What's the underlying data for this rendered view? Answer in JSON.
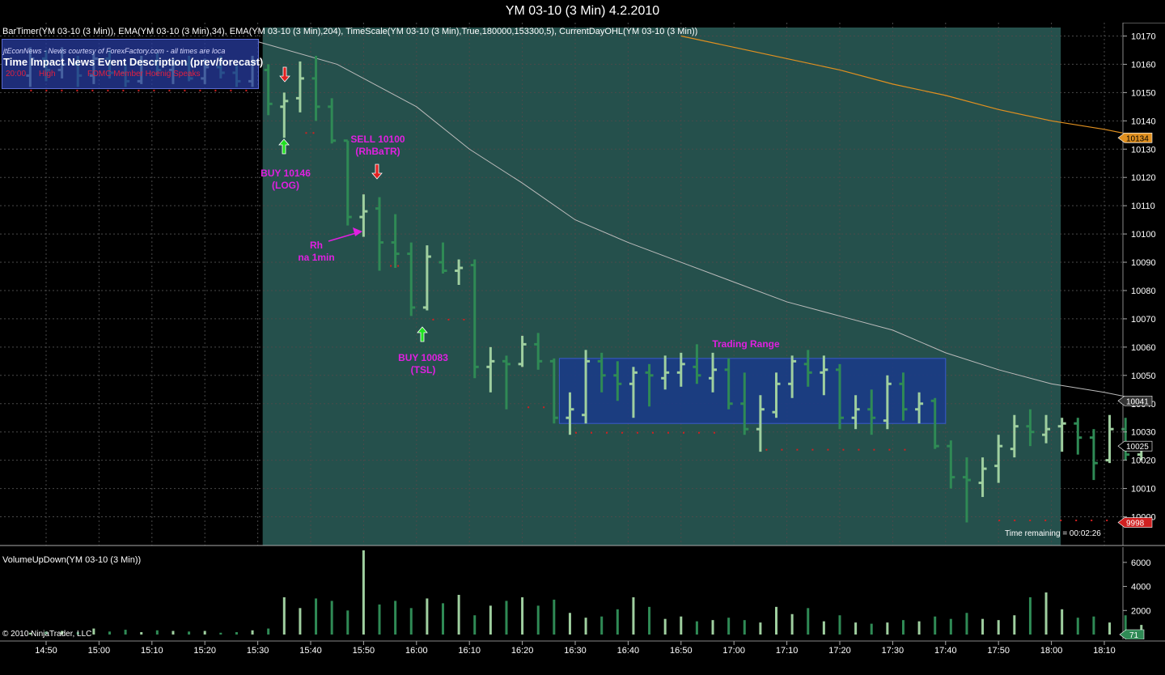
{
  "window_title": "YM 03-10 (3 Min)  4.2.2010",
  "indicator_label": "BarTimer(YM 03-10 (3 Min)), EMA(YM 03-10 (3 Min),34), EMA(YM 03-10 (3 Min),204), TimeScale(YM 03-10 (3 Min),True,180000,153300,5), CurrentDayOHL(YM 03-10 (3 Min))",
  "news": {
    "title": "jtEconNews - News courtesy of ForexFactory.com - all times are loca",
    "header": "Time   Impact    News Event Description  (prev/forecast)",
    "time": "20:00",
    "impact": "High",
    "event": "FOMC Member Hoenig Speaks"
  },
  "annotations": {
    "buy1": [
      "BUY 10146",
      "(LOG)"
    ],
    "sell1": [
      "SELL 10100",
      "(RhBaTR)"
    ],
    "rh": [
      "Rh",
      "na 1min"
    ],
    "buy2": [
      "BUY 10083",
      "(TSL)"
    ],
    "range": "Trading Range"
  },
  "time_remaining": "Time remaining = 00:02:26",
  "volume_label": "VolumeUpDown(YM 03-10 (3 Min))",
  "copyright": "© 2010 NinjaTrader, LLC",
  "colors": {
    "background": "#000000",
    "session_bg": "#25504c",
    "range_box": "#1a3a8a",
    "up_bar": "#9fcf9f",
    "down_bar": "#2f8a55",
    "ema34": "#bbbbbb",
    "ema204": "#e09020",
    "annotation": "#e020e0",
    "dots": "#d02020"
  },
  "chart_data": {
    "type": "ohlc",
    "title": "YM 03-10 (3 Min)  4.2.2010",
    "y_ticks": [
      10170,
      10160,
      10150,
      10140,
      10130,
      10120,
      10110,
      10100,
      10090,
      10080,
      10070,
      10060,
      10050,
      10040,
      10030,
      10020,
      10010,
      10000
    ],
    "y_range": [
      9995,
      10173
    ],
    "x_ticks": [
      "14:50",
      "15:00",
      "15:10",
      "15:20",
      "15:30",
      "15:40",
      "15:50",
      "16:00",
      "16:10",
      "16:20",
      "16:30",
      "16:40",
      "16:50",
      "17:00",
      "17:10",
      "17:20",
      "17:30",
      "17:40",
      "17:50",
      "18:00",
      "18:10"
    ],
    "price_markers": {
      "ema204": 10134,
      "ema34": 10041,
      "last": 10025,
      "low": 9998
    },
    "ema34": [
      {
        "t": "15:30",
        "v": 10168
      },
      {
        "t": "15:45",
        "v": 10160
      },
      {
        "t": "16:00",
        "v": 10145
      },
      {
        "t": "16:10",
        "v": 10130
      },
      {
        "t": "16:20",
        "v": 10118
      },
      {
        "t": "16:30",
        "v": 10105
      },
      {
        "t": "16:40",
        "v": 10097
      },
      {
        "t": "16:50",
        "v": 10090
      },
      {
        "t": "17:00",
        "v": 10083
      },
      {
        "t": "17:10",
        "v": 10076
      },
      {
        "t": "17:20",
        "v": 10071
      },
      {
        "t": "17:30",
        "v": 10066
      },
      {
        "t": "17:40",
        "v": 10058
      },
      {
        "t": "17:50",
        "v": 10052
      },
      {
        "t": "18:00",
        "v": 10047
      },
      {
        "t": "18:10",
        "v": 10044
      },
      {
        "t": "18:18",
        "v": 10041
      }
    ],
    "ema204": [
      {
        "t": "16:50",
        "v": 10170
      },
      {
        "t": "17:00",
        "v": 10166
      },
      {
        "t": "17:10",
        "v": 10162
      },
      {
        "t": "17:20",
        "v": 10158
      },
      {
        "t": "17:30",
        "v": 10153
      },
      {
        "t": "17:40",
        "v": 10149
      },
      {
        "t": "17:50",
        "v": 10144
      },
      {
        "t": "18:00",
        "v": 10140
      },
      {
        "t": "18:10",
        "v": 10137
      },
      {
        "t": "18:18",
        "v": 10134
      }
    ],
    "bars": [
      {
        "t": "14:47",
        "o": 10156,
        "h": 10166,
        "l": 10152,
        "c": 10162
      },
      {
        "t": "14:50",
        "o": 10162,
        "h": 10165,
        "l": 10154,
        "c": 10158
      },
      {
        "t": "14:53",
        "o": 10158,
        "h": 10166,
        "l": 10155,
        "c": 10160
      },
      {
        "t": "14:56",
        "o": 10160,
        "h": 10163,
        "l": 10152,
        "c": 10156
      },
      {
        "t": "14:59",
        "o": 10156,
        "h": 10164,
        "l": 10153,
        "c": 10162
      },
      {
        "t": "15:02",
        "o": 10162,
        "h": 10165,
        "l": 10155,
        "c": 10157
      },
      {
        "t": "15:05",
        "o": 10157,
        "h": 10160,
        "l": 10152,
        "c": 10154
      },
      {
        "t": "15:08",
        "o": 10154,
        "h": 10163,
        "l": 10153,
        "c": 10161
      },
      {
        "t": "15:11",
        "o": 10161,
        "h": 10164,
        "l": 10156,
        "c": 10158
      },
      {
        "t": "15:14",
        "o": 10158,
        "h": 10162,
        "l": 10153,
        "c": 10160
      },
      {
        "t": "15:17",
        "o": 10160,
        "h": 10163,
        "l": 10154,
        "c": 10155
      },
      {
        "t": "15:20",
        "o": 10155,
        "h": 10162,
        "l": 10153,
        "c": 10159
      },
      {
        "t": "15:23",
        "o": 10159,
        "h": 10163,
        "l": 10155,
        "c": 10157
      },
      {
        "t": "15:26",
        "o": 10157,
        "h": 10160,
        "l": 10152,
        "c": 10154
      },
      {
        "t": "15:29",
        "o": 10154,
        "h": 10163,
        "l": 10152,
        "c": 10161
      },
      {
        "t": "15:32",
        "o": 10158,
        "h": 10160,
        "l": 10142,
        "c": 10146
      },
      {
        "t": "15:35",
        "o": 10145,
        "h": 10150,
        "l": 10134,
        "c": 10147
      },
      {
        "t": "15:38",
        "o": 10148,
        "h": 10161,
        "l": 10143,
        "c": 10155
      },
      {
        "t": "15:41",
        "o": 10155,
        "h": 10163,
        "l": 10140,
        "c": 10145
      },
      {
        "t": "15:44",
        "o": 10145,
        "h": 10148,
        "l": 10132,
        "c": 10133
      },
      {
        "t": "15:47",
        "o": 10133,
        "h": 10133,
        "l": 10103,
        "c": 10106
      },
      {
        "t": "15:50",
        "o": 10106,
        "h": 10114,
        "l": 10099,
        "c": 10108
      },
      {
        "t": "15:53",
        "o": 10109,
        "h": 10113,
        "l": 10087,
        "c": 10097
      },
      {
        "t": "15:56",
        "o": 10097,
        "h": 10107,
        "l": 10088,
        "c": 10093
      },
      {
        "t": "15:59",
        "o": 10093,
        "h": 10097,
        "l": 10071,
        "c": 10074
      },
      {
        "t": "16:02",
        "o": 10074,
        "h": 10096,
        "l": 10073,
        "c": 10092
      },
      {
        "t": "16:05",
        "o": 10090,
        "h": 10097,
        "l": 10086,
        "c": 10087
      },
      {
        "t": "16:08",
        "o": 10087,
        "h": 10091,
        "l": 10082,
        "c": 10088
      },
      {
        "t": "16:11",
        "o": 10089,
        "h": 10091,
        "l": 10049,
        "c": 10053
      },
      {
        "t": "16:14",
        "o": 10053,
        "h": 10060,
        "l": 10044,
        "c": 10055
      },
      {
        "t": "16:17",
        "o": 10055,
        "h": 10057,
        "l": 10038,
        "c": 10054
      },
      {
        "t": "16:20",
        "o": 10054,
        "h": 10064,
        "l": 10053,
        "c": 10061
      },
      {
        "t": "16:23",
        "o": 10061,
        "h": 10065,
        "l": 10052,
        "c": 10055
      },
      {
        "t": "16:26",
        "o": 10055,
        "h": 10056,
        "l": 10033,
        "c": 10035
      },
      {
        "t": "16:29",
        "o": 10035,
        "h": 10044,
        "l": 10029,
        "c": 10038
      },
      {
        "t": "16:32",
        "o": 10036,
        "h": 10059,
        "l": 10033,
        "c": 10055
      },
      {
        "t": "16:35",
        "o": 10055,
        "h": 10058,
        "l": 10044,
        "c": 10050
      },
      {
        "t": "16:38",
        "o": 10050,
        "h": 10055,
        "l": 10041,
        "c": 10047
      },
      {
        "t": "16:41",
        "o": 10047,
        "h": 10053,
        "l": 10035,
        "c": 10051
      },
      {
        "t": "16:44",
        "o": 10051,
        "h": 10054,
        "l": 10039,
        "c": 10050
      },
      {
        "t": "16:47",
        "o": 10049,
        "h": 10057,
        "l": 10045,
        "c": 10051
      },
      {
        "t": "16:50",
        "o": 10051,
        "h": 10058,
        "l": 10046,
        "c": 10054
      },
      {
        "t": "16:53",
        "o": 10053,
        "h": 10061,
        "l": 10047,
        "c": 10050
      },
      {
        "t": "16:56",
        "o": 10049,
        "h": 10058,
        "l": 10044,
        "c": 10052
      },
      {
        "t": "16:59",
        "o": 10052,
        "h": 10056,
        "l": 10038,
        "c": 10040
      },
      {
        "t": "17:02",
        "o": 10040,
        "h": 10051,
        "l": 10029,
        "c": 10031
      },
      {
        "t": "17:05",
        "o": 10031,
        "h": 10043,
        "l": 10023,
        "c": 10038
      },
      {
        "t": "17:08",
        "o": 10037,
        "h": 10051,
        "l": 10035,
        "c": 10047
      },
      {
        "t": "17:11",
        "o": 10047,
        "h": 10057,
        "l": 10042,
        "c": 10055
      },
      {
        "t": "17:14",
        "o": 10054,
        "h": 10059,
        "l": 10046,
        "c": 10051
      },
      {
        "t": "17:17",
        "o": 10051,
        "h": 10057,
        "l": 10043,
        "c": 10052
      },
      {
        "t": "17:20",
        "o": 10052,
        "h": 10054,
        "l": 10031,
        "c": 10035
      },
      {
        "t": "17:23",
        "o": 10035,
        "h": 10043,
        "l": 10031,
        "c": 10038
      },
      {
        "t": "17:26",
        "o": 10038,
        "h": 10045,
        "l": 10029,
        "c": 10035
      },
      {
        "t": "17:29",
        "o": 10034,
        "h": 10050,
        "l": 10031,
        "c": 10047
      },
      {
        "t": "17:32",
        "o": 10047,
        "h": 10051,
        "l": 10034,
        "c": 10038
      },
      {
        "t": "17:35",
        "o": 10038,
        "h": 10044,
        "l": 10033,
        "c": 10040
      },
      {
        "t": "17:38",
        "o": 10041,
        "h": 10042,
        "l": 10024,
        "c": 10025
      },
      {
        "t": "17:41",
        "o": 10025,
        "h": 10027,
        "l": 10010,
        "c": 10014
      },
      {
        "t": "17:44",
        "o": 10014,
        "h": 10021,
        "l": 9998,
        "c": 10013
      },
      {
        "t": "17:47",
        "o": 10012,
        "h": 10021,
        "l": 10007,
        "c": 10017
      },
      {
        "t": "17:50",
        "o": 10018,
        "h": 10029,
        "l": 10012,
        "c": 10025
      },
      {
        "t": "17:53",
        "o": 10024,
        "h": 10036,
        "l": 10021,
        "c": 10032
      },
      {
        "t": "17:56",
        "o": 10032,
        "h": 10038,
        "l": 10025,
        "c": 10030
      },
      {
        "t": "17:59",
        "o": 10029,
        "h": 10036,
        "l": 10026,
        "c": 10031
      },
      {
        "t": "18:02",
        "o": 10032,
        "h": 10035,
        "l": 10023,
        "c": 10033
      },
      {
        "t": "18:05",
        "o": 10033,
        "h": 10035,
        "l": 10022,
        "c": 10028
      },
      {
        "t": "18:08",
        "o": 10028,
        "h": 10031,
        "l": 10013,
        "c": 10019
      },
      {
        "t": "18:11",
        "o": 10020,
        "h": 10036,
        "l": 10019,
        "c": 10031
      },
      {
        "t": "18:14",
        "o": 10031,
        "h": 10035,
        "l": 10020,
        "c": 10022
      },
      {
        "t": "18:17",
        "o": 10022,
        "h": 10026,
        "l": 10020,
        "c": 10024
      }
    ],
    "volume": {
      "y_ticks": [
        6000,
        4000,
        2000
      ],
      "y_range": [
        0,
        7000
      ],
      "values": [
        150,
        250,
        300,
        200,
        500,
        250,
        400,
        200,
        350,
        300,
        250,
        300,
        150,
        200,
        350,
        500,
        3100,
        2200,
        3000,
        2800,
        2000,
        7000,
        2500,
        2800,
        2200,
        3000,
        2600,
        3300,
        1600,
        2400,
        2800,
        3100,
        2400,
        2900,
        1800,
        1400,
        1500,
        2100,
        3100,
        2300,
        1300,
        1500,
        1100,
        1200,
        1400,
        1200,
        1000,
        2300,
        1700,
        2200,
        1100,
        1600,
        1000,
        900,
        1000,
        1200,
        1100,
        1500,
        1300,
        1800,
        1300,
        1200,
        1600,
        3100,
        3500,
        2100,
        1400,
        1500,
        1000,
        1600,
        800,
        1200,
        600
      ],
      "last": 71
    },
    "session_shade": {
      "from": "15:32",
      "to": "18:01"
    },
    "trading_range_box": {
      "from": "16:27",
      "to": "17:40",
      "top": 10056,
      "bottom": 10033
    }
  }
}
